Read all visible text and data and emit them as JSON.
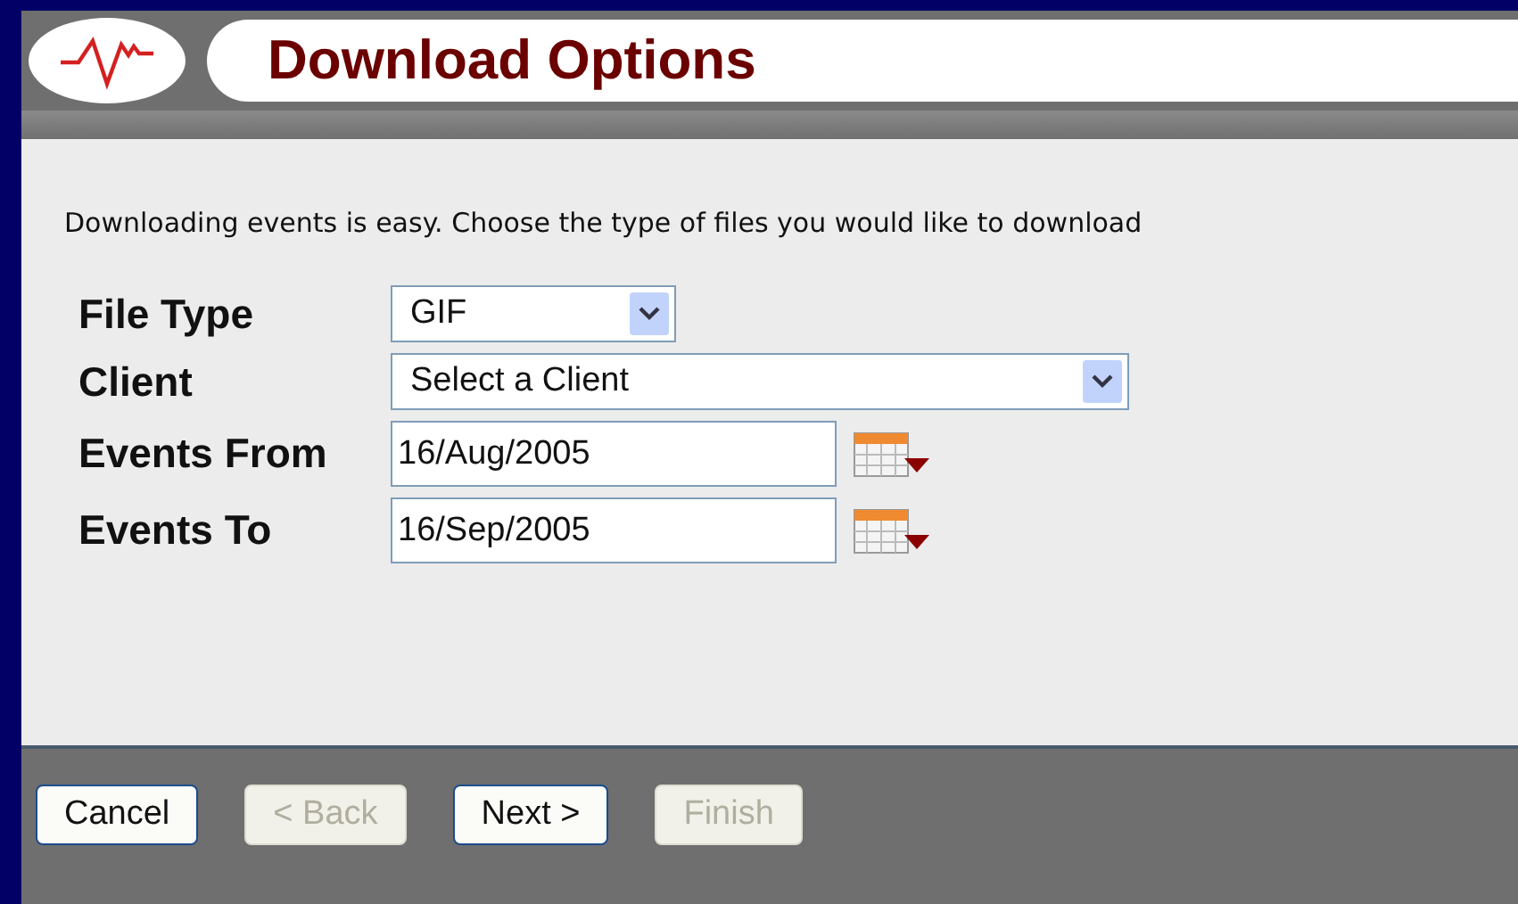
{
  "header": {
    "title": "Download Options"
  },
  "intro": "Downloading events is easy. Choose the type of files you would like to download",
  "fields": [
    {
      "kind": "short-select",
      "label": "File Type",
      "value": "GIF"
    },
    {
      "kind": "long-select",
      "label": "Client",
      "value": "Select a Client"
    },
    {
      "kind": "date",
      "label": "Events From",
      "value": "16/Aug/2005"
    },
    {
      "kind": "date",
      "label": "Events To",
      "value": "16/Sep/2005"
    }
  ],
  "buttons": [
    {
      "label": "Cancel",
      "disabled": false
    },
    {
      "label": "< Back",
      "disabled": true
    },
    {
      "label": "Next >",
      "disabled": false
    },
    {
      "label": "Finish",
      "disabled": true
    }
  ]
}
